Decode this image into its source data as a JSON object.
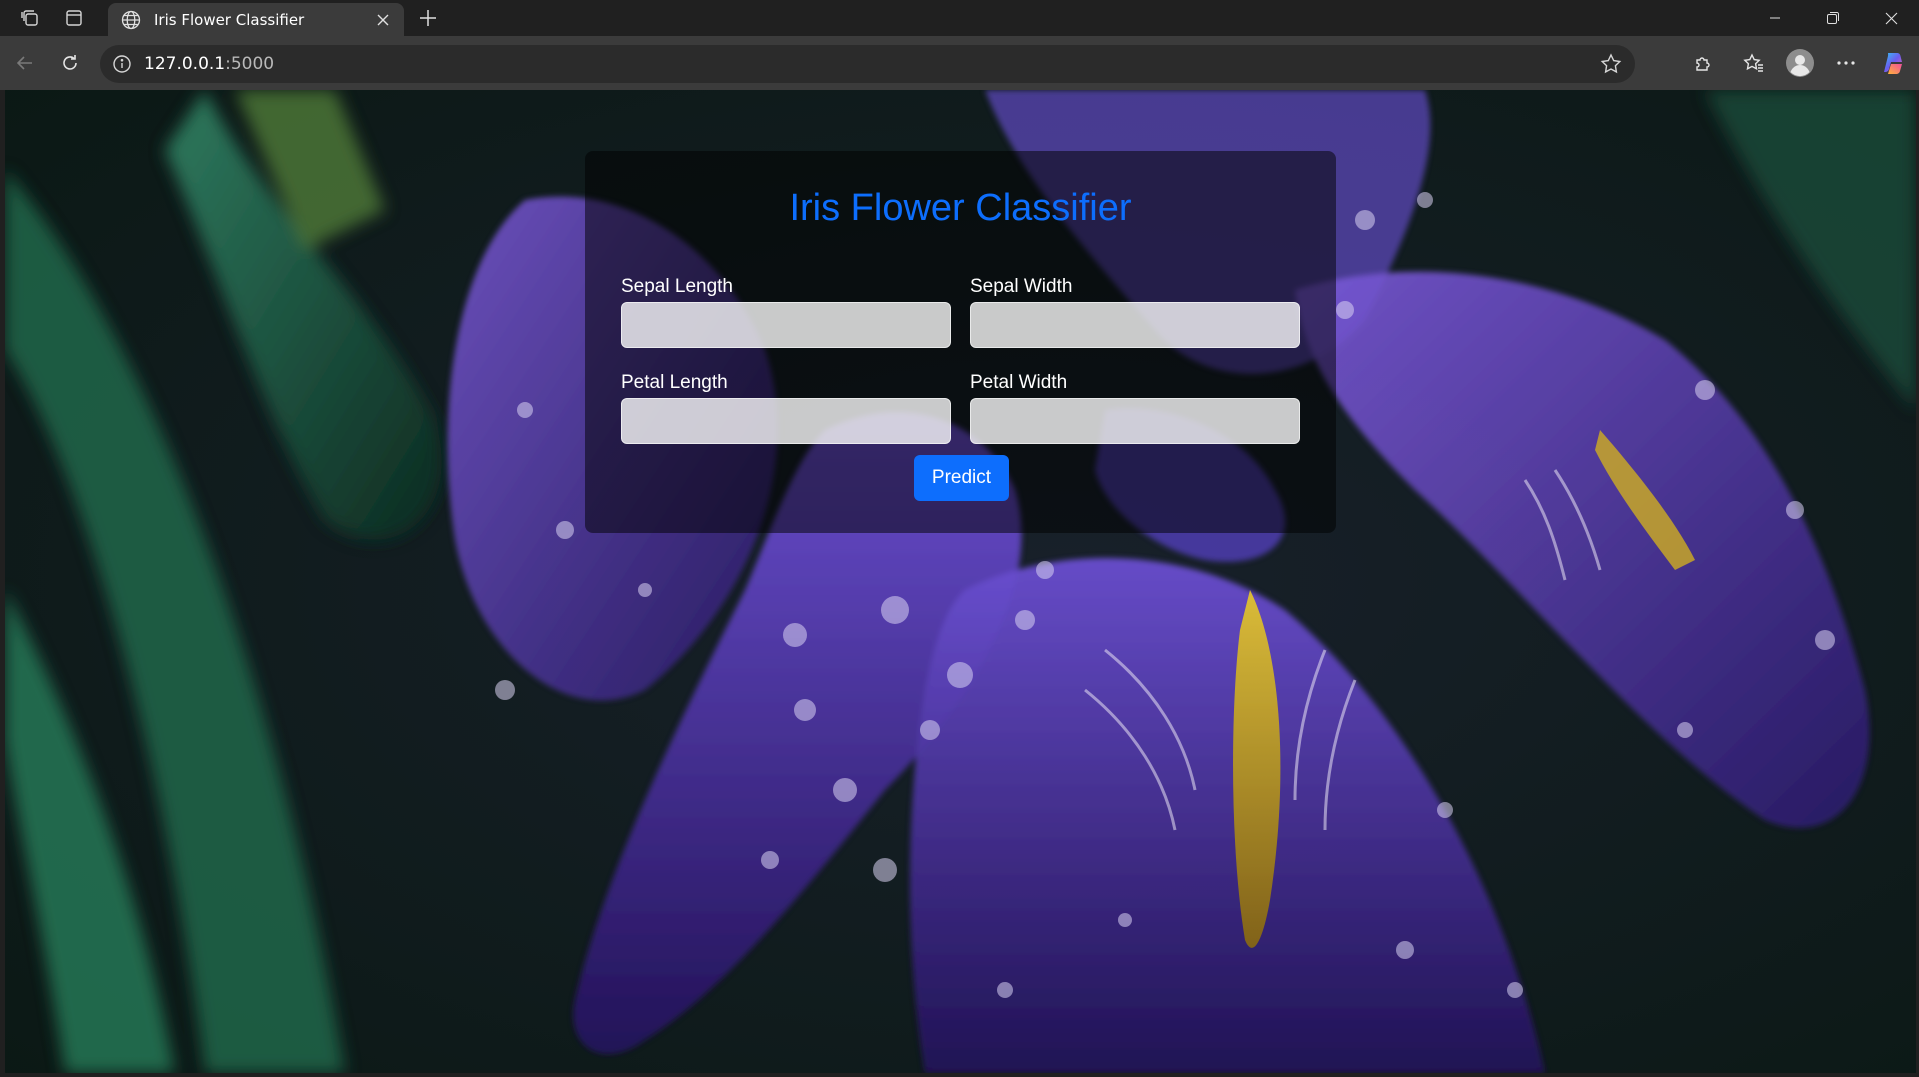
{
  "browser": {
    "tab_title": "Iris Flower Classifier",
    "url_host": "127.0.0.1",
    "url_port": ":5000"
  },
  "page": {
    "title": "Iris Flower Classifier",
    "fields": [
      {
        "label": "Sepal Length",
        "value": ""
      },
      {
        "label": "Sepal Width",
        "value": ""
      },
      {
        "label": "Petal Length",
        "value": ""
      },
      {
        "label": "Petal Width",
        "value": ""
      }
    ],
    "submit_label": "Predict"
  },
  "colors": {
    "accent": "#0d6efd",
    "card_overlay": "rgba(0,0,0,0.5)",
    "chrome_dark": "#202020",
    "chrome_toolbar": "#3b3b3b"
  },
  "icons": {
    "workspaces": "workspaces-icon",
    "vertical_tabs": "vertical-tabs-icon",
    "globe": "globe-icon",
    "close": "close-icon",
    "new_tab": "plus-icon",
    "back": "back-arrow-icon",
    "refresh": "refresh-icon",
    "info": "info-icon",
    "favorite": "star-icon",
    "extensions": "puzzle-icon",
    "favorites": "favorites-icon",
    "profile": "profile-icon",
    "menu": "more-icon",
    "copilot": "copilot-icon"
  }
}
